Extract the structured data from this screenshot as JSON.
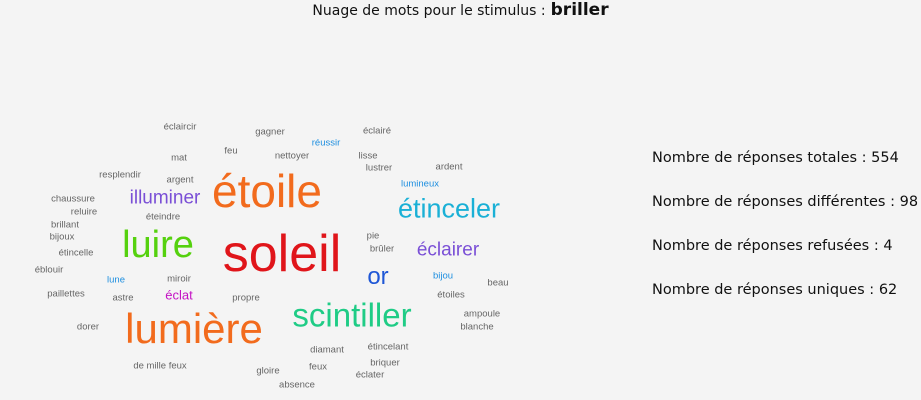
{
  "header": {
    "prefix": "Nuage de mots pour le stimulus :",
    "stimulus": "briller"
  },
  "colors": {
    "small": "#666666",
    "etoile": "#f26b1d",
    "soleil": "#e0151a",
    "luire": "#55d10e",
    "illuminer": "#7a4fd6",
    "etinceler": "#1ab0d6",
    "eclairer": "#7a4fd6",
    "or": "#1f57d6",
    "lumiere": "#f26b1d",
    "scintiller": "#1fcc86",
    "eclat": "#c413c4",
    "blue_small": "#1e8fe0"
  },
  "cloud": [
    {
      "text": "éclaircir",
      "color": "small",
      "weight": 1
    },
    {
      "text": "gagner",
      "color": "small",
      "weight": 1
    },
    {
      "text": "réussir",
      "color": "blue_small",
      "weight": 1
    },
    {
      "text": "éclairé",
      "color": "small",
      "weight": 1
    },
    {
      "text": "feu",
      "color": "small",
      "weight": 1
    },
    {
      "text": "mat",
      "color": "small",
      "weight": 1
    },
    {
      "text": "nettoyer",
      "color": "small",
      "weight": 1
    },
    {
      "text": "lisse",
      "color": "small",
      "weight": 1
    },
    {
      "text": "lustrer",
      "color": "small",
      "weight": 1
    },
    {
      "text": "ardent",
      "color": "small",
      "weight": 1
    },
    {
      "text": "resplendir",
      "color": "small",
      "weight": 1
    },
    {
      "text": "argent",
      "color": "small",
      "weight": 1
    },
    {
      "text": "lumineux",
      "color": "blue_small",
      "weight": 1
    },
    {
      "text": "étoile",
      "color": "etoile",
      "weight": 5
    },
    {
      "text": "illuminer",
      "color": "illuminer",
      "weight": 3
    },
    {
      "text": "chaussure",
      "color": "small",
      "weight": 1
    },
    {
      "text": "reluire",
      "color": "small",
      "weight": 1
    },
    {
      "text": "éteindre",
      "color": "small",
      "weight": 1
    },
    {
      "text": "étinceler",
      "color": "etinceler",
      "weight": 4
    },
    {
      "text": "brillant",
      "color": "small",
      "weight": 1
    },
    {
      "text": "bijoux",
      "color": "small",
      "weight": 1
    },
    {
      "text": "pie",
      "color": "small",
      "weight": 1
    },
    {
      "text": "luire",
      "color": "luire",
      "weight": 4
    },
    {
      "text": "soleil",
      "color": "soleil",
      "weight": 6
    },
    {
      "text": "brûler",
      "color": "small",
      "weight": 1
    },
    {
      "text": "éclairer",
      "color": "eclairer",
      "weight": 3
    },
    {
      "text": "étincelle",
      "color": "small",
      "weight": 1
    },
    {
      "text": "éblouir",
      "color": "small",
      "weight": 1
    },
    {
      "text": "or",
      "color": "or",
      "weight": 3
    },
    {
      "text": "bijou",
      "color": "blue_small",
      "weight": 1
    },
    {
      "text": "lune",
      "color": "blue_small",
      "weight": 1
    },
    {
      "text": "miroir",
      "color": "small",
      "weight": 1
    },
    {
      "text": "beau",
      "color": "small",
      "weight": 1
    },
    {
      "text": "paillettes",
      "color": "small",
      "weight": 1
    },
    {
      "text": "astre",
      "color": "small",
      "weight": 1
    },
    {
      "text": "éclat",
      "color": "eclat",
      "weight": 2
    },
    {
      "text": "propre",
      "color": "small",
      "weight": 1
    },
    {
      "text": "étoiles",
      "color": "small",
      "weight": 1
    },
    {
      "text": "lumière",
      "color": "lumiere",
      "weight": 5
    },
    {
      "text": "scintiller",
      "color": "scintiller",
      "weight": 4
    },
    {
      "text": "ampoule",
      "color": "small",
      "weight": 1
    },
    {
      "text": "dorer",
      "color": "small",
      "weight": 1
    },
    {
      "text": "blanche",
      "color": "small",
      "weight": 1
    },
    {
      "text": "étincelant",
      "color": "small",
      "weight": 1
    },
    {
      "text": "diamant",
      "color": "small",
      "weight": 1
    },
    {
      "text": "de mille feux",
      "color": "small",
      "weight": 1
    },
    {
      "text": "briquer",
      "color": "small",
      "weight": 1
    },
    {
      "text": "gloire",
      "color": "small",
      "weight": 1
    },
    {
      "text": "feux",
      "color": "small",
      "weight": 1
    },
    {
      "text": "éclater",
      "color": "small",
      "weight": 1
    },
    {
      "text": "absence",
      "color": "small",
      "weight": 1
    }
  ],
  "stats": [
    {
      "label": "Nombre de réponses totales :",
      "value": "554"
    },
    {
      "label": "Nombre de réponses différentes :",
      "value": "98"
    },
    {
      "label": "Nombre de réponses refusées :",
      "value": "4"
    },
    {
      "label": "Nombre de réponses uniques :",
      "value": "62"
    }
  ]
}
